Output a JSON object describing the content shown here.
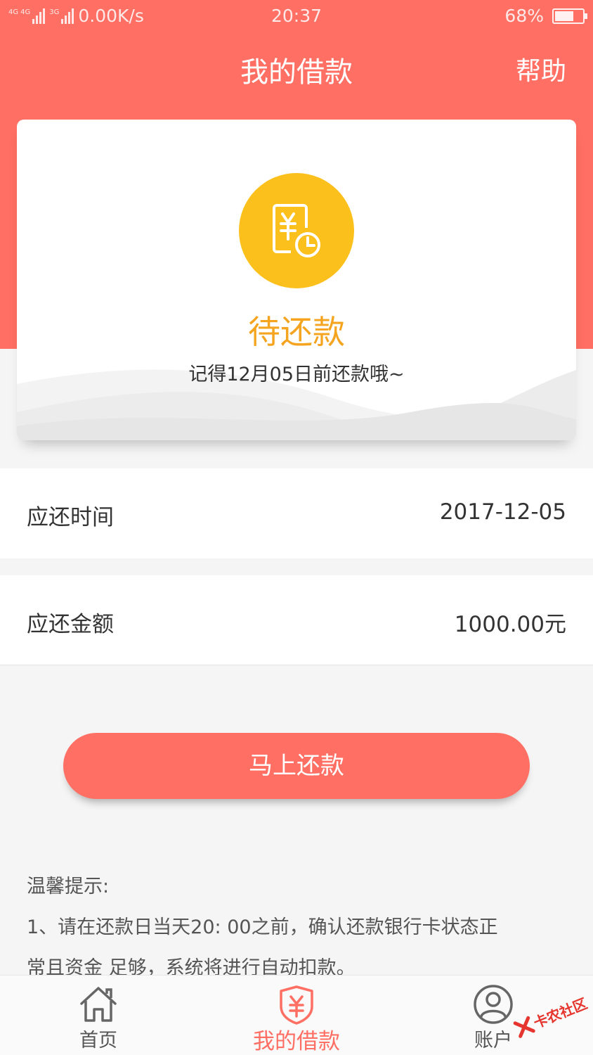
{
  "status_bar": {
    "network_1": "4G",
    "network_2": "4G",
    "network_3": "3G",
    "speed": "0.00K/s",
    "time": "20:37",
    "battery": "68%",
    "battery_level": 0.68
  },
  "header": {
    "title": "我的借款",
    "help_label": "帮助"
  },
  "status_card": {
    "icon": "yuan-clock-icon",
    "status": "待还款",
    "message": "记得12月05日前还款哦~"
  },
  "repayment": {
    "due_date_label": "应还时间",
    "due_date_value": "2017-12-05",
    "amount_label": "应还金额",
    "amount_value": "1000.00元"
  },
  "action": {
    "repay_button": "马上还款"
  },
  "tips": {
    "title": "温馨提示:",
    "line1": "1、请在还款日当天20: 00之前，确认还款银行卡状态正",
    "line2": "常且资金 足够，系统将进行自动扣款。"
  },
  "tabbar": {
    "tabs": [
      {
        "label": "首页",
        "icon": "home-icon"
      },
      {
        "label": "我的借款",
        "icon": "yuan-shield-icon",
        "active": true
      },
      {
        "label": "账户",
        "icon": "user-icon"
      }
    ]
  },
  "watermark": {
    "text": "卡农社区"
  },
  "colors": {
    "brand": "#ff6f63",
    "status_yellow": "#fcc01c",
    "status_text": "#f5a41f"
  }
}
